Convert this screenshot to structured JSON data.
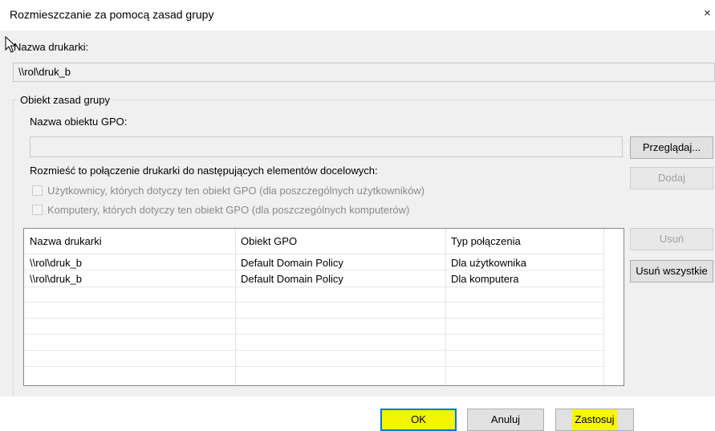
{
  "window": {
    "title": "Rozmieszczanie za pomocą zasad grupy",
    "close_glyph": "×"
  },
  "printer": {
    "label": "Nazwa drukarki:",
    "value": "\\\\rol\\druk_b"
  },
  "gpo_group": {
    "legend": "Obiekt zasad grupy",
    "name_label": "Nazwa obiektu GPO:",
    "name_value": "",
    "browse_button": "Przeglądaj...",
    "deploy_label": "Rozmieść to połączenie drukarki do następujących elementów docelowych:",
    "add_button": "Dodaj",
    "checkbox_users": {
      "label": "Użytkownicy, których dotyczy ten obiekt GPO (dla poszczególnych użytkowników)",
      "checked": false,
      "enabled": false
    },
    "checkbox_computers": {
      "label": "Komputery, których dotyczy ten obiekt GPO (dla poszczególnych komputerów)",
      "checked": false,
      "enabled": false
    }
  },
  "table": {
    "headers": [
      "Nazwa drukarki",
      "Obiekt GPO",
      "Typ połączenia"
    ],
    "rows": [
      [
        "\\\\rol\\druk_b",
        "Default Domain Policy",
        "Dla użytkownika"
      ],
      [
        "\\\\rol\\druk_b",
        "Default Domain Policy",
        "Dla komputera"
      ]
    ]
  },
  "side_buttons": {
    "remove": "Usuń",
    "remove_all": "Usuń wszystkie"
  },
  "footer": {
    "ok": "OK",
    "cancel": "Anuluj",
    "apply": "Zastosuj"
  },
  "colors": {
    "highlight": "#f7f700",
    "focus_border": "#0078d7",
    "dialog_bg": "#f0f0f0"
  },
  "icons": {
    "cursor": "arrow-cursor-icon"
  }
}
